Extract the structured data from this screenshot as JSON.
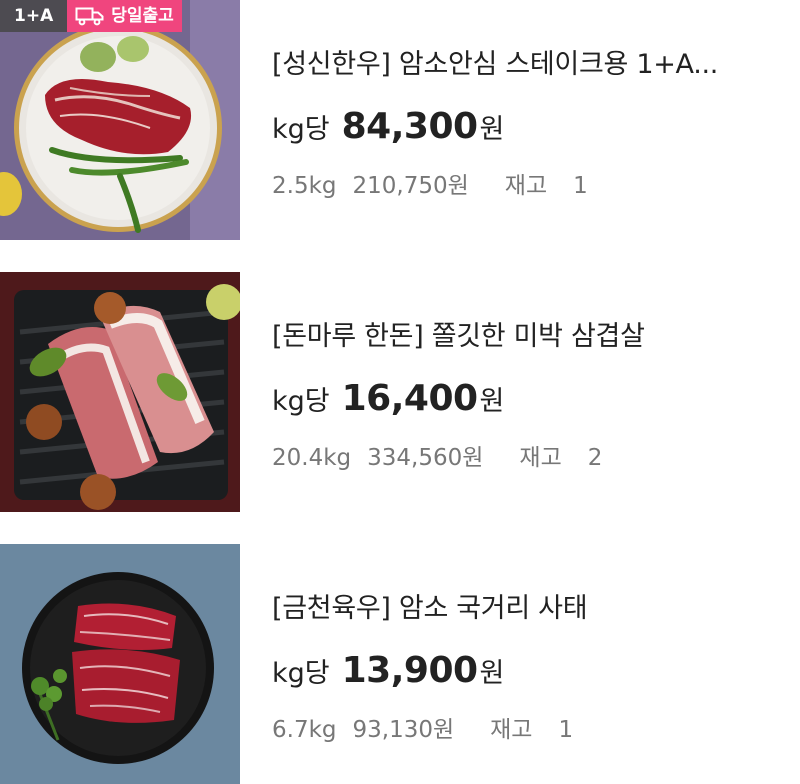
{
  "products": [
    {
      "grade_badge": "1+A",
      "ship_badge": "당일출고",
      "title": "[성신한우] 암소안심 스테이크용 1+A...",
      "unit_label": "kg당",
      "price": "84,300",
      "currency": "원",
      "weight": "2.5kg",
      "total": "210,750원",
      "stock_label": "재고",
      "stock": "1"
    },
    {
      "title": "[돈마루 한돈] 쫄깃한 미박 삼겹살",
      "unit_label": "kg당",
      "price": "16,400",
      "currency": "원",
      "weight": "20.4kg",
      "total": "334,560원",
      "stock_label": "재고",
      "stock": "2"
    },
    {
      "title": "[금천육우] 암소 국거리 사태",
      "unit_label": "kg당",
      "price": "13,900",
      "currency": "원",
      "weight": "6.7kg",
      "total": "93,130원",
      "stock_label": "재고",
      "stock": "1"
    }
  ],
  "colors": {
    "ship_badge_bg": "#f0457e",
    "grade_badge_bg": "#464646",
    "text_primary": "#222222",
    "text_secondary": "#777777"
  }
}
